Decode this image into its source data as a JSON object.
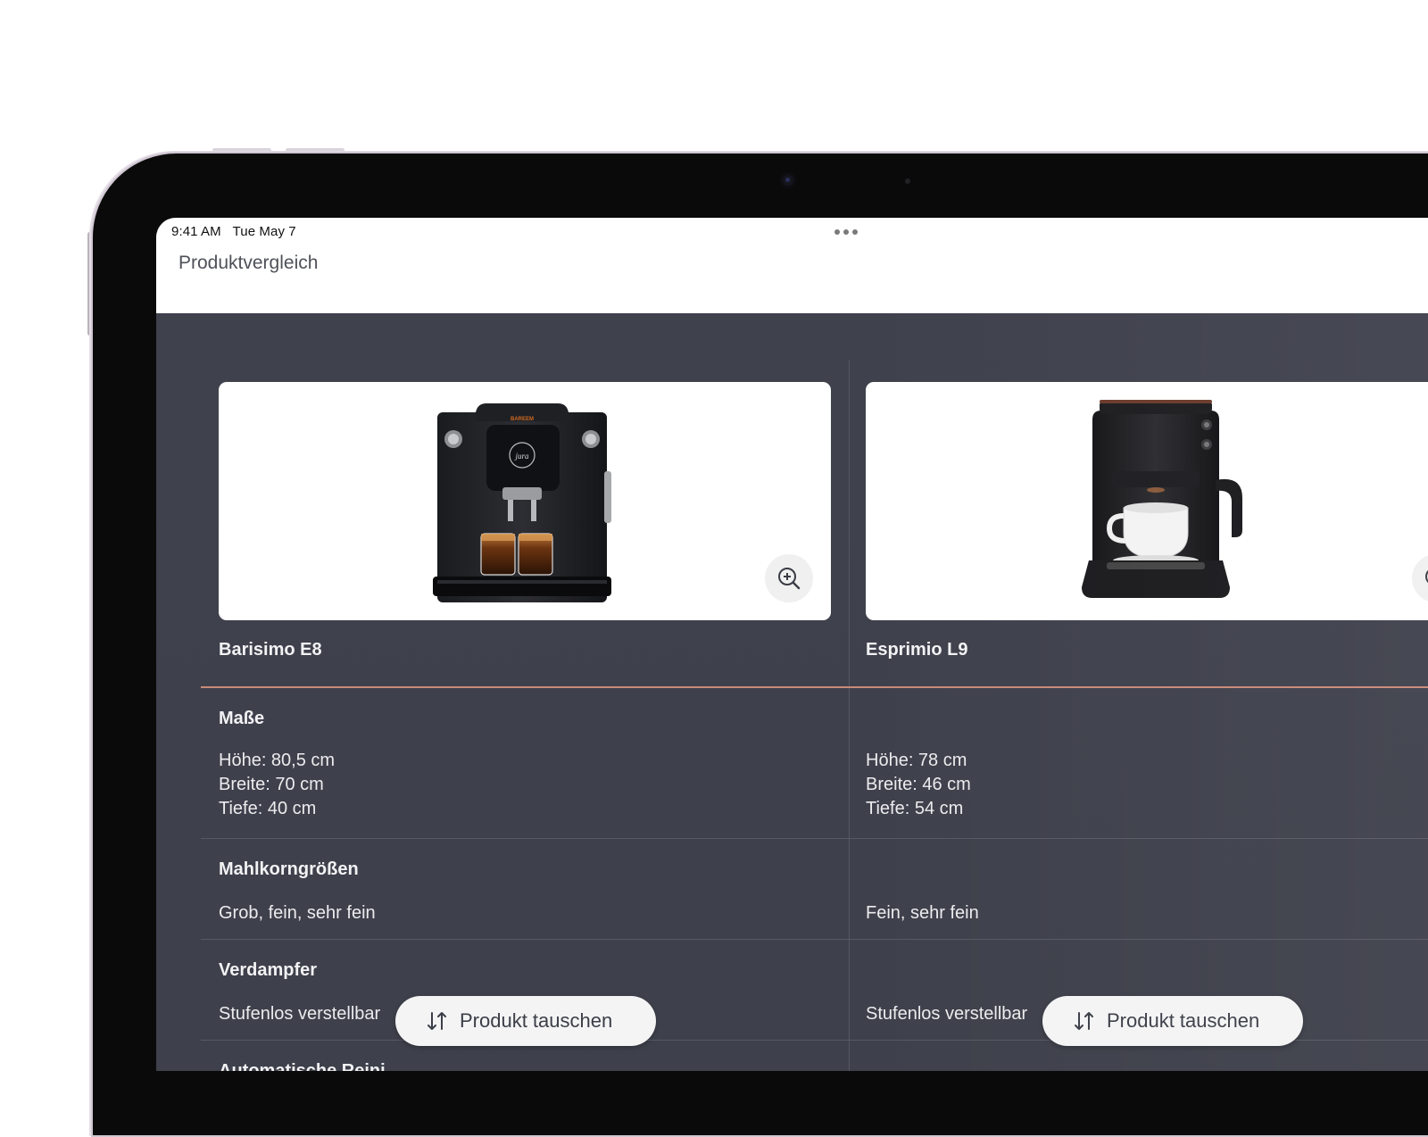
{
  "status": {
    "time": "9:41 AM",
    "date": "Tue May 7"
  },
  "nav": {
    "title": "Produktvergleich"
  },
  "products": [
    {
      "name": "Barisimo E8",
      "masse": [
        "Höhe: 80,5 cm",
        "Breite: 70 cm",
        "Tiefe: 40 cm"
      ],
      "mahlkorn": "Grob, fein, sehr fein",
      "verdampfer": "Stufenlos verstellbar",
      "swap_label": "Produkt tauschen",
      "image_icon": "espresso-machine-image",
      "machine_label": "BAREEM"
    },
    {
      "name": "Esprimio L9",
      "masse": [
        "Höhe: 78 cm",
        "Breite: 46 cm",
        "Tiefe: 54 cm"
      ],
      "mahlkorn": "Fein, sehr fein",
      "verdampfer": "Stufenlos verstellbar",
      "swap_label": "Produkt tauschen",
      "image_icon": "coffee-maker-image"
    }
  ],
  "sections": {
    "masse": "Maße",
    "mahlkorn": "Mahlkorngrößen",
    "verdampfer": "Verdampfer",
    "next_partial": "Automatische Reini"
  },
  "colors": {
    "accent": "#c98a78",
    "background": "#40424e"
  }
}
